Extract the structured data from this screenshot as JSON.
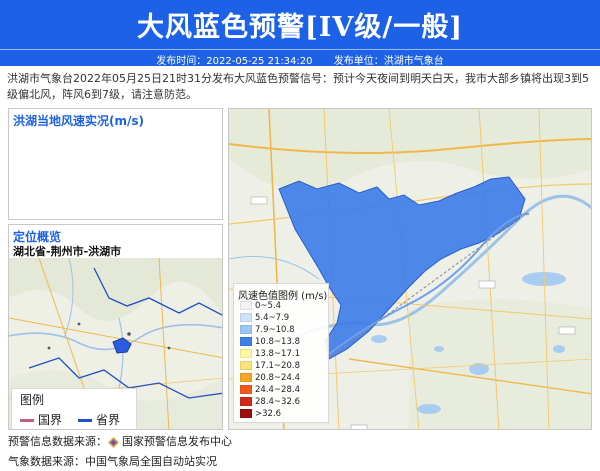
{
  "header": {
    "title": "大风蓝色预警[IV级/一般]",
    "publish_time_label": "发布时间：2022-05-25 21:34:20",
    "publisher_label": "发布单位：洪湖市气象台",
    "bg_color": "#1d62e6"
  },
  "description": "洪湖市气象台2022年05月25日21时31分发布大风蓝色预警信号：预计今天夜间到明天白天，我市大部乡镇将出现3到5级偏北风，阵风6到7级，请注意防范。",
  "wind_panel": {
    "title": "洪湖当地风速实况(m/s)"
  },
  "location_panel": {
    "title": "定位概览",
    "location": "湖北省-荆州市-洪湖市",
    "legend": {
      "title": "图例",
      "items": [
        {
          "label": "国界",
          "color": "#c0607a"
        },
        {
          "label": "省界",
          "color": "#1f4fc4"
        }
      ]
    }
  },
  "wind_legend": {
    "title": "风速色值图例 (m/s)",
    "items": [
      {
        "label": "0~5.4",
        "color": "#f2f2f2"
      },
      {
        "label": "5.4~7.9",
        "color": "#cfe2f7"
      },
      {
        "label": "7.9~10.8",
        "color": "#9cc6f2"
      },
      {
        "label": "10.8~13.8",
        "color": "#3e7ee8"
      },
      {
        "label": "13.8~17.1",
        "color": "#fff8a3"
      },
      {
        "label": "17.1~20.8",
        "color": "#fbe27a"
      },
      {
        "label": "20.8~24.4",
        "color": "#f5a623"
      },
      {
        "label": "24.4~28.4",
        "color": "#ef5a1c"
      },
      {
        "label": "28.4~32.6",
        "color": "#d22a18"
      },
      {
        "label": ">32.6",
        "color": "#9b0f10"
      }
    ]
  },
  "footer": {
    "warning_source": "预警信息数据来源：",
    "warning_source_name": "国家预警信息发布中心",
    "weather_source": "气象数据来源：中国气象局全国自动站实况"
  }
}
